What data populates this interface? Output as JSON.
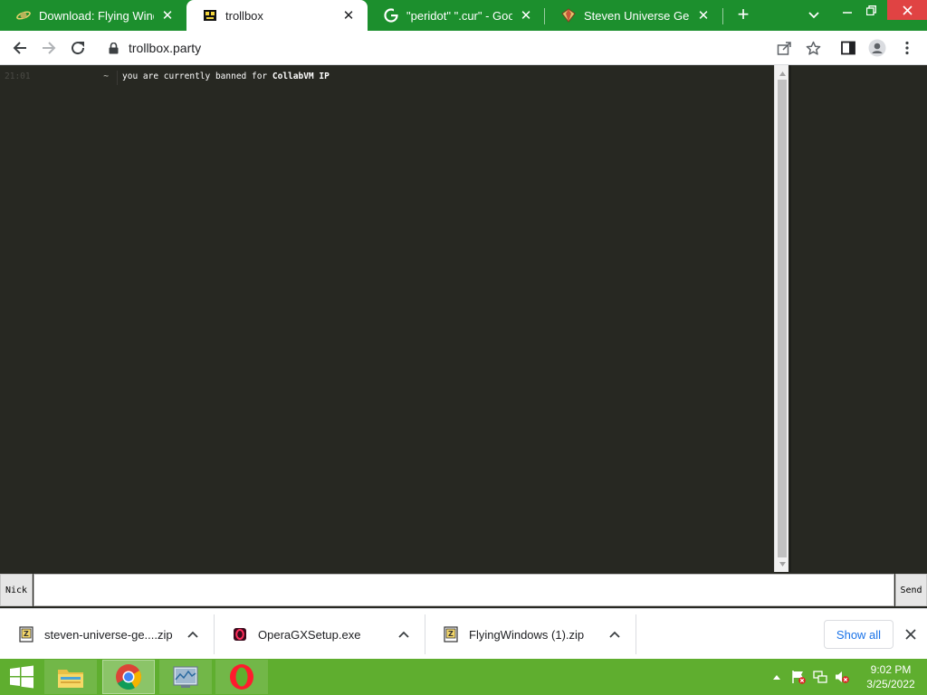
{
  "browser": {
    "tabs": [
      {
        "title": "Download: Flying Windows",
        "active": false
      },
      {
        "title": "trollbox",
        "active": true
      },
      {
        "title": "\"peridot\" \".cur\" - Google Search",
        "active": false
      },
      {
        "title": "Steven Universe Gems Cursors",
        "active": false
      }
    ],
    "new_tab_symbol": "+",
    "url": "trollbox.party",
    "colors": {
      "frame": "#1c8f2d",
      "active_tab": "#ffffff"
    }
  },
  "chat": {
    "messages": [
      {
        "time": "21:01",
        "nick": "~",
        "text_prefix": "you are currently banned for ",
        "text_emphasis": "CollabVM IP"
      }
    ],
    "colors": {
      "background": "#272822",
      "text": "#ffffff"
    }
  },
  "input": {
    "nick_label": "Nick",
    "send_label": "Send",
    "value": ""
  },
  "downloads": {
    "items": [
      {
        "name": "steven-universe-ge....zip",
        "icon": "zip-icon"
      },
      {
        "name": "OperaGXSetup.exe",
        "icon": "opera-gx-icon"
      },
      {
        "name": "FlyingWindows (1).zip",
        "icon": "zip-icon"
      }
    ],
    "show_all_label": "Show all"
  },
  "taskbar": {
    "apps": [
      "file-explorer-icon",
      "chrome-icon",
      "task-manager-icon",
      "opera-icon"
    ],
    "clock": {
      "time": "9:02 PM",
      "date": "3/25/2022"
    },
    "colors": {
      "background": "#5fae2f"
    }
  }
}
